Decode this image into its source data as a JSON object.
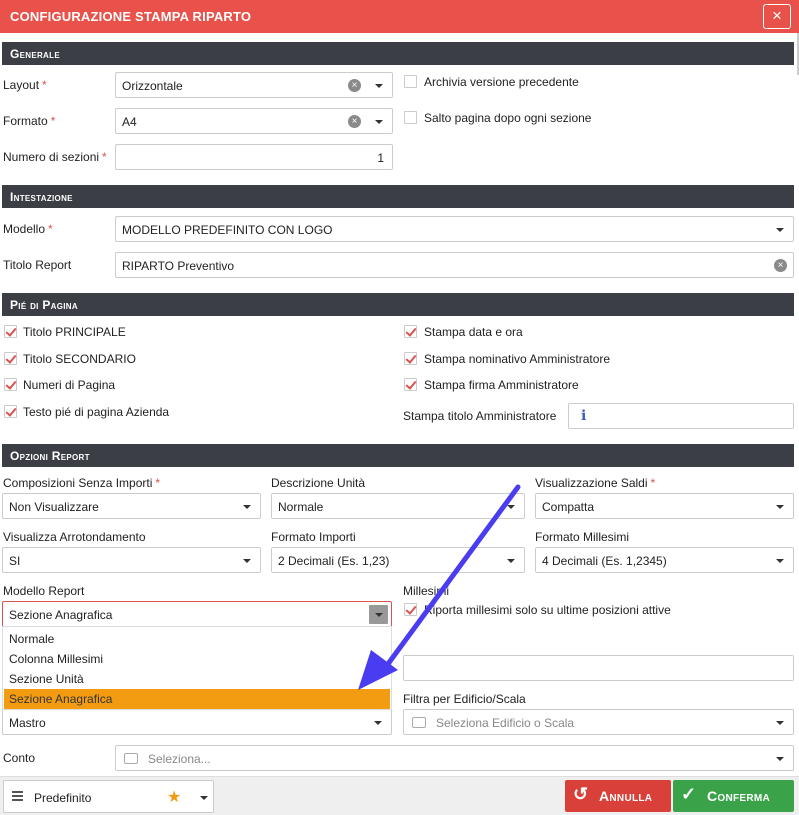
{
  "window": {
    "title": "CONFIGURAZIONE STAMPA RIPARTO",
    "close_icon": "×"
  },
  "sections": {
    "generale": "Generale",
    "intestazione": "Intestazione",
    "pie": "Pié di Pagina",
    "opzioni": "Opzioni Report"
  },
  "generale": {
    "layout_label": "Layout",
    "layout_value": "Orizzontale",
    "formato_label": "Formato",
    "formato_value": "A4",
    "sezioni_label": "Numero di sezioni",
    "sezioni_value": "1",
    "archivia_label": "Archivia versione precedente",
    "archivia_checked": false,
    "salto_label": "Salto pagina dopo ogni sezione",
    "salto_checked": false
  },
  "intestazione": {
    "modello_label": "Modello",
    "modello_value": "MODELLO PREDEFINITO CON LOGO",
    "titolo_label": "Titolo Report",
    "titolo_value": "RIPARTO Preventivo"
  },
  "pie": {
    "left": [
      {
        "label": "Titolo PRINCIPALE",
        "checked": true
      },
      {
        "label": "Titolo SECONDARIO",
        "checked": true
      },
      {
        "label": "Numeri di Pagina",
        "checked": true
      },
      {
        "label": "Testo pié di pagina Azienda",
        "checked": true
      }
    ],
    "right": [
      {
        "label": "Stampa data e ora",
        "checked": true
      },
      {
        "label": "Stampa nominativo Amministratore",
        "checked": true
      },
      {
        "label": "Stampa firma Amministratore",
        "checked": true
      }
    ],
    "titolo_amm_label": "Stampa titolo Amministratore",
    "titolo_amm_icon": "info-icon"
  },
  "opzioni": {
    "composizioni_label": "Composizioni Senza Importi",
    "composizioni_value": "Non Visualizzare",
    "descrizione_label": "Descrizione Unità",
    "descrizione_value": "Normale",
    "saldi_label": "Visualizzazione Saldi",
    "saldi_value": "Compatta",
    "arrotondamento_label": "Visualizza Arrotondamento",
    "arrotondamento_value": "SI",
    "importi_label": "Formato Importi",
    "importi_value": "2 Decimali (Es. 1,23)",
    "millesimi_fmt_label": "Formato Millesimi",
    "millesimi_fmt_value": "4 Decimali (Es. 1,2345)",
    "modello_label": "Modello Report",
    "modello_value": "Sezione Anagrafica",
    "modello_options": [
      "Normale",
      "Colonna Millesimi",
      "Sezione Unità",
      "Sezione Anagrafica"
    ],
    "millesimi_label": "Millesimi",
    "millesimi_check_label": "Riporta millesimi solo su ultime posizioni attive",
    "millesimi_checked": true,
    "mastro_value": "Mastro",
    "filtra_label": "Filtra per Edificio/Scala",
    "filtra_placeholder": "Seleziona Edificio o Scala",
    "conto_label": "Conto",
    "conto_placeholder": "Seleziona..."
  },
  "footer": {
    "preset_value": "Predefinito",
    "cancel_label": "Annulla",
    "confirm_label": "Conferma"
  },
  "colors": {
    "titlebar": "#e8524a",
    "section": "#3b3e44",
    "highlight": "#f39c12",
    "cancel": "#d9403a",
    "confirm": "#3aa34a",
    "arrow": "#4a3cf0"
  }
}
